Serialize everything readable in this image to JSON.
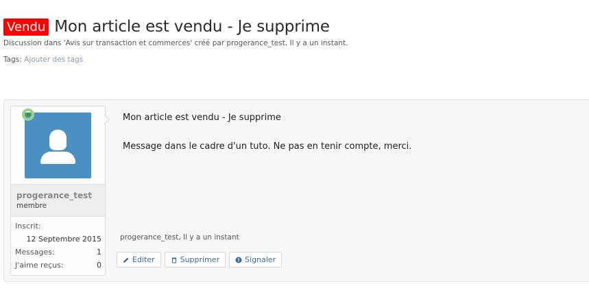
{
  "thread": {
    "prefix": "Vendu",
    "title": "Mon article est vendu - Je supprime",
    "meta": "Discussion dans 'Avis sur transaction et commerces' créé par progerance_test, Il y a un instant.",
    "tags_label": "Tags:",
    "tags_add": "Ajouter des tags"
  },
  "post": {
    "username": "progerance_test",
    "user_title": "membre",
    "stats": [
      {
        "label": "Inscrit:",
        "value": ""
      },
      {
        "label": "",
        "value": "12 Septembre 2015"
      },
      {
        "label": "Messages:",
        "value": "1"
      },
      {
        "label": "J'aime reçus:",
        "value": "0"
      }
    ],
    "message_title": "Mon article est vendu - Je supprime",
    "message_body": "Message dans le cadre d'un tuto. Ne pas en tenir compte, merci.",
    "info": "progerance_test, Il y a un instant",
    "actions": {
      "edit": "Editer",
      "delete": "Supprimer",
      "report": "Signaler"
    }
  },
  "colors": {
    "prefix_bg": "#ff0000",
    "avatar_bg": "#4a90c2",
    "online_ring": "#9fd08a",
    "link": "#3c6c9a"
  },
  "icons": [
    "avatar-icon",
    "online-indicator-icon",
    "pencil-icon",
    "trash-icon",
    "warning-icon"
  ]
}
